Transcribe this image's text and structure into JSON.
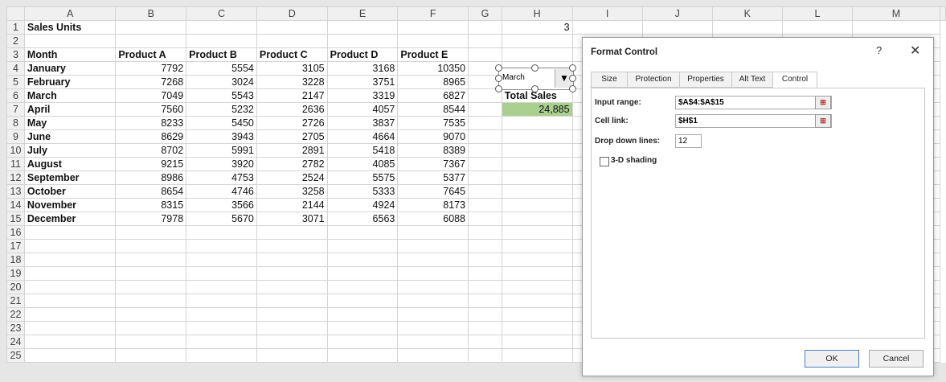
{
  "columns": [
    "A",
    "B",
    "C",
    "D",
    "E",
    "F",
    "G",
    "H",
    "I",
    "J",
    "K",
    "L",
    "M"
  ],
  "sheet_title": "Sales Units",
  "h1_value": "3",
  "headers": [
    "Month",
    "Product A",
    "Product B",
    "Product C",
    "Product D",
    "Product E"
  ],
  "rows": [
    {
      "month": "January",
      "a": "7792",
      "b": "5554",
      "c": "3105",
      "d": "3168",
      "e": "10350"
    },
    {
      "month": "February",
      "a": "7268",
      "b": "3024",
      "c": "3228",
      "d": "3751",
      "e": "8965"
    },
    {
      "month": "March",
      "a": "7049",
      "b": "5543",
      "c": "2147",
      "d": "3319",
      "e": "6827"
    },
    {
      "month": "April",
      "a": "7560",
      "b": "5232",
      "c": "2636",
      "d": "4057",
      "e": "8544"
    },
    {
      "month": "May",
      "a": "8233",
      "b": "5450",
      "c": "2726",
      "d": "3837",
      "e": "7535"
    },
    {
      "month": "June",
      "a": "8629",
      "b": "3943",
      "c": "2705",
      "d": "4664",
      "e": "9070"
    },
    {
      "month": "July",
      "a": "8702",
      "b": "5991",
      "c": "2891",
      "d": "5418",
      "e": "8389"
    },
    {
      "month": "August",
      "a": "9215",
      "b": "3920",
      "c": "2782",
      "d": "4085",
      "e": "7367"
    },
    {
      "month": "September",
      "a": "8986",
      "b": "4753",
      "c": "2524",
      "d": "5575",
      "e": "5377"
    },
    {
      "month": "October",
      "a": "8654",
      "b": "4746",
      "c": "3258",
      "d": "5333",
      "e": "7645"
    },
    {
      "month": "November",
      "a": "8315",
      "b": "3566",
      "c": "2144",
      "d": "4924",
      "e": "8173"
    },
    {
      "month": "December",
      "a": "7978",
      "b": "5670",
      "c": "3071",
      "d": "6563",
      "e": "6088"
    }
  ],
  "total_sales_label": "Total Sales",
  "total_sales_value": "24,885",
  "combo_value": "March",
  "dialog": {
    "title": "Format Control",
    "help": "?",
    "close": "✕",
    "tabs": [
      "Size",
      "Protection",
      "Properties",
      "Alt Text",
      "Control"
    ],
    "input_range_label": "Input range:",
    "input_range_value": "$A$4:$A$15",
    "cell_link_label": "Cell link:",
    "cell_link_value": "$H$1",
    "drop_down_label": "Drop down lines:",
    "drop_down_value": "12",
    "shading_label": "3-D shading",
    "ok": "OK",
    "cancel": "Cancel"
  },
  "colors": {
    "total_fill": "#a9d08e",
    "ok_border": "#4a7fc1"
  }
}
